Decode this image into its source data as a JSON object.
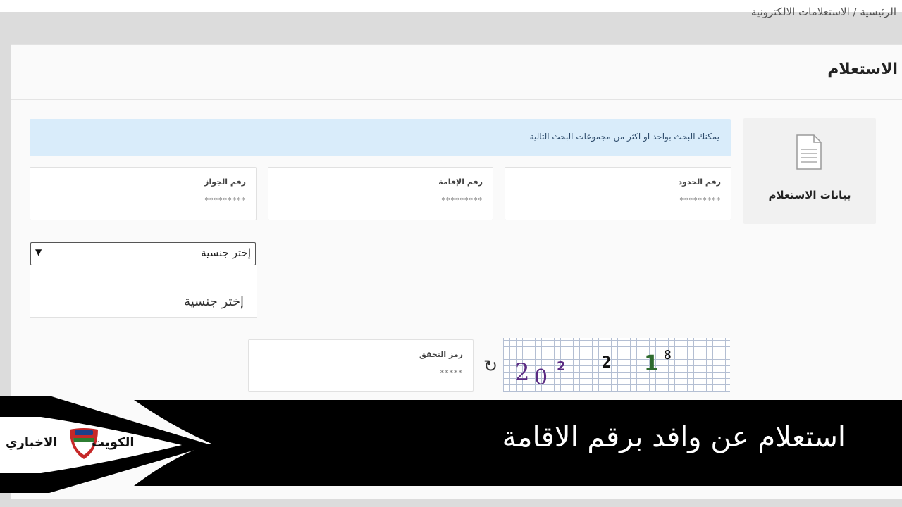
{
  "breadcrumb": "الرئيسية / الاستعلامات الالكترونية",
  "page_title": "الاستعلام",
  "sidebar": {
    "label": "بيانات الاستعلام",
    "icon": "document-icon"
  },
  "info_message": "يمكنك البحث بواحد او اكثر من مجموعات البحث التالية",
  "fields": [
    {
      "label": "رقم الحدود",
      "value": "*********"
    },
    {
      "label": "رقم الإقامة",
      "value": "*********"
    },
    {
      "label": "رقم الجواز",
      "value": "*********"
    }
  ],
  "nationality": {
    "selected": "إختر جنسية",
    "options": [
      "إختر جنسية"
    ]
  },
  "captcha": {
    "label": "رمز التحقق",
    "value": "*****",
    "image_text": "2 0 2 2 1 8"
  },
  "banner": {
    "headline": "استعلام عن وافد برقم الاقامة",
    "brand_part1": "الكويت",
    "brand_part2": "الاخباري",
    "brand_colors": [
      "#000000",
      "#ffffff",
      "#2e7d32",
      "#c62828"
    ]
  },
  "colors": {
    "info_bg": "#d9ecfa",
    "banner_bg": "#000000",
    "page_bg": "#dcdcdc"
  }
}
